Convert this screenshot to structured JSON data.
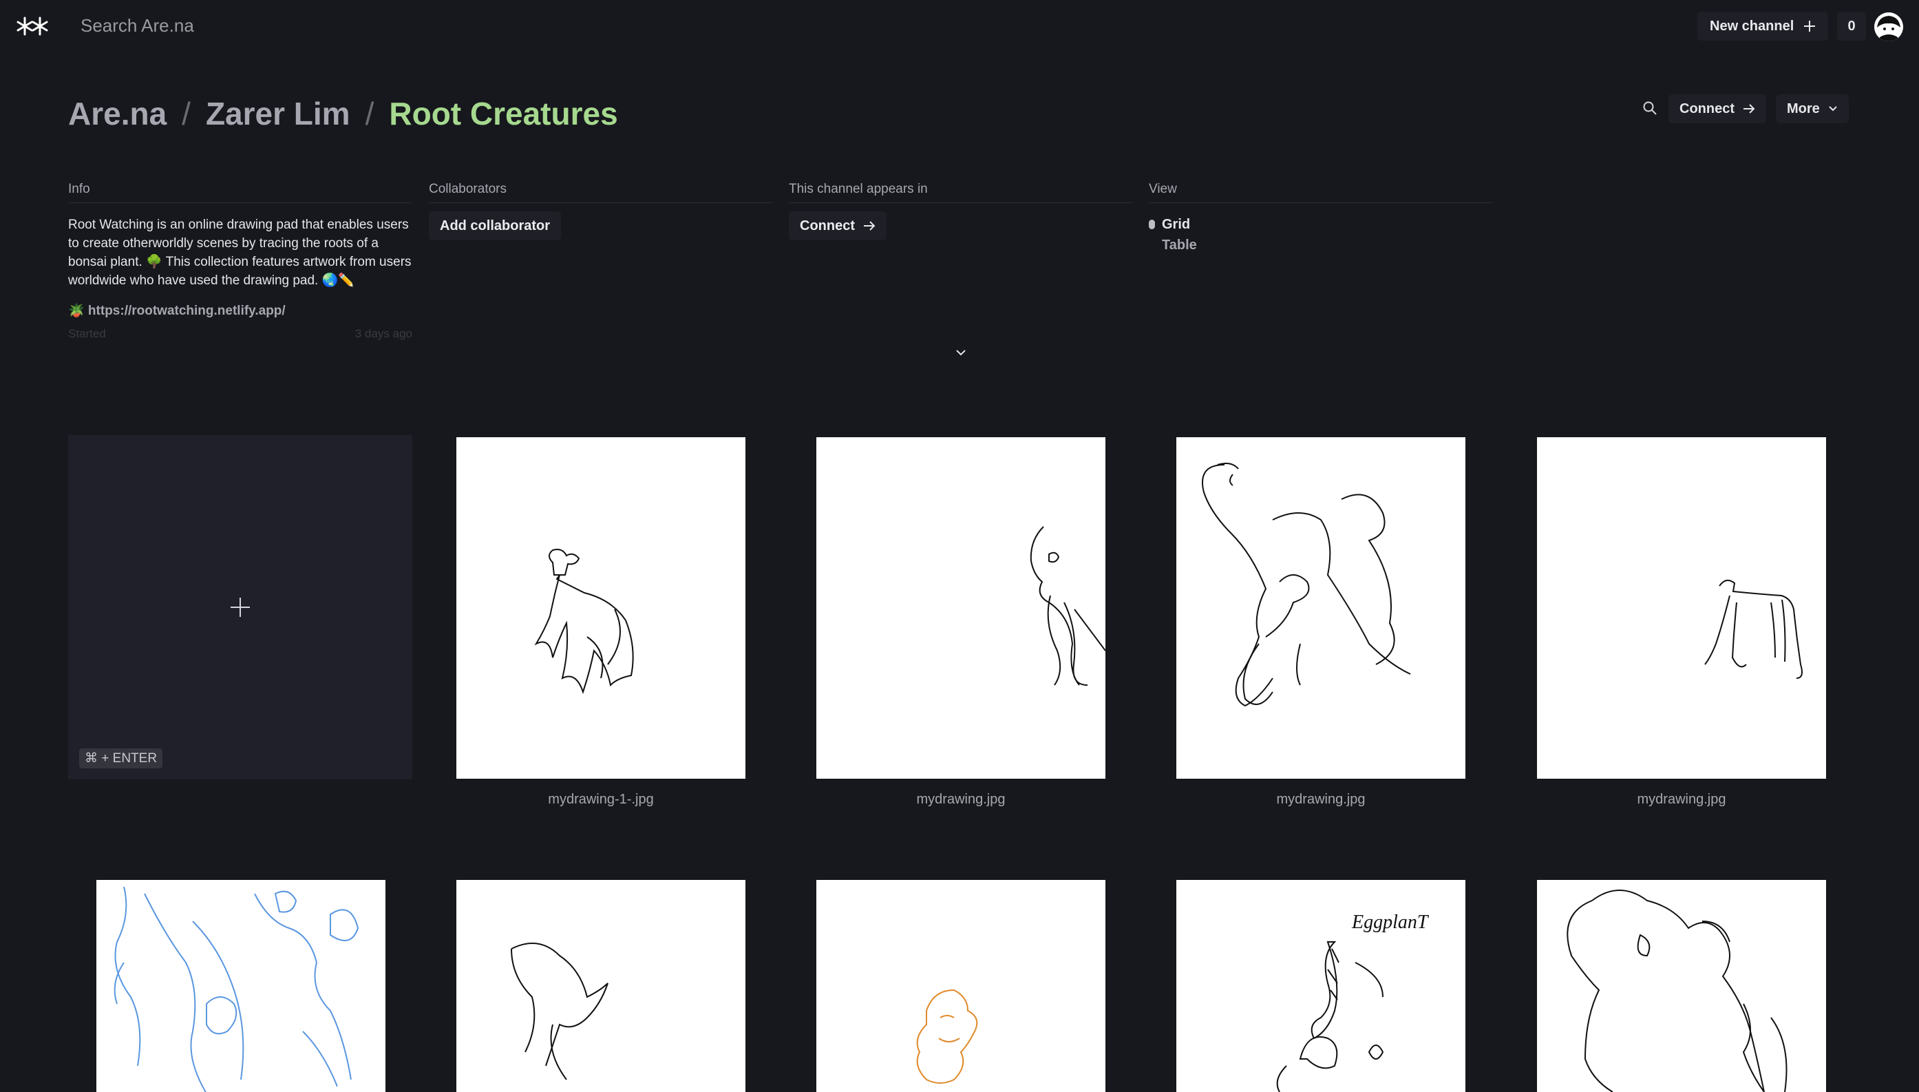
{
  "topbar": {
    "search_label": "Search Are.na",
    "new_channel_label": "New channel",
    "count": "0"
  },
  "breadcrumb": {
    "root": "Are.na",
    "owner": "Zarer Lim",
    "channel": "Root Creatures"
  },
  "header_actions": {
    "connect_label": "Connect",
    "more_label": "More"
  },
  "info": {
    "heading": "Info",
    "description": "Root Watching is an online drawing pad that enables users to create otherworldly scenes by tracing the roots of a bonsai plant. 🌳 This collection features artwork from users worldwide who have used the drawing pad. 🌏✏️",
    "link": "🪴 https://rootwatching.netlify.app/",
    "faded_left": "Started",
    "faded_right": "3 days ago"
  },
  "collaborators": {
    "heading": "Collaborators",
    "add_label": "Add collaborator"
  },
  "appears_in": {
    "heading": "This channel appears in",
    "connect_label": "Connect"
  },
  "view": {
    "heading": "View",
    "options": [
      "Grid",
      "Table"
    ],
    "selected": "Grid"
  },
  "add_block": {
    "shortcut": "⌘ + ENTER"
  },
  "blocks": [
    {
      "title": "mydrawing-1-.jpg"
    },
    {
      "title": "mydrawing.jpg"
    },
    {
      "title": "mydrawing.jpg"
    },
    {
      "title": "mydrawing.jpg"
    }
  ],
  "row2_annotations": {
    "eggplant": "EggplanT"
  },
  "colors": {
    "background": "#17181d",
    "accent_green": "#a6d98f",
    "drawing_blue": "#5a97e0",
    "drawing_orange": "#e08a2a"
  }
}
